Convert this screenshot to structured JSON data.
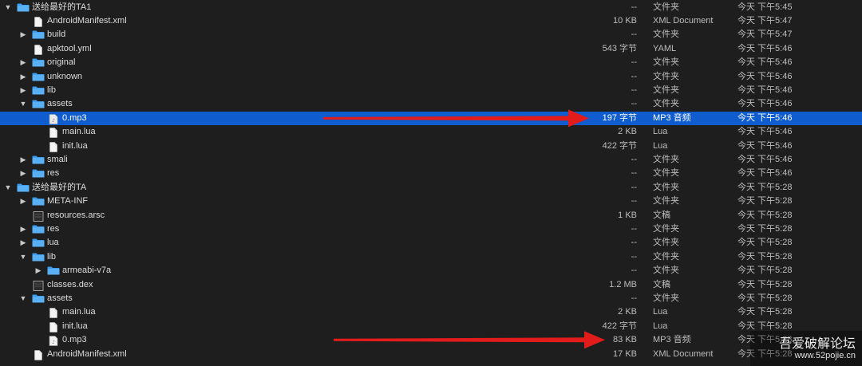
{
  "colors": {
    "background": "#1e1e1e",
    "selection": "#0f5ccf",
    "folder_blue": "#3b9cf0",
    "arrow_red": "#e21b1b"
  },
  "rows": [
    {
      "name": "送给最好的TA1",
      "size": "--",
      "kind": "文件夹",
      "date": "今天 下午5:45",
      "depth": 0,
      "icon": "folder-icon",
      "disclosure": "expanded"
    },
    {
      "name": "AndroidManifest.xml",
      "size": "10 KB",
      "kind": "XML Document",
      "date": "今天 下午5:47",
      "depth": 1,
      "icon": "document-icon",
      "disclosure": "none"
    },
    {
      "name": "build",
      "size": "--",
      "kind": "文件夹",
      "date": "今天 下午5:47",
      "depth": 1,
      "icon": "folder-icon",
      "disclosure": "collapsed"
    },
    {
      "name": "apktool.yml",
      "size": "543 字节",
      "kind": "YAML",
      "date": "今天 下午5:46",
      "depth": 1,
      "icon": "document-icon",
      "disclosure": "none"
    },
    {
      "name": "original",
      "size": "--",
      "kind": "文件夹",
      "date": "今天 下午5:46",
      "depth": 1,
      "icon": "folder-icon",
      "disclosure": "collapsed"
    },
    {
      "name": "unknown",
      "size": "--",
      "kind": "文件夹",
      "date": "今天 下午5:46",
      "depth": 1,
      "icon": "folder-icon",
      "disclosure": "collapsed"
    },
    {
      "name": "lib",
      "size": "--",
      "kind": "文件夹",
      "date": "今天 下午5:46",
      "depth": 1,
      "icon": "folder-icon",
      "disclosure": "collapsed"
    },
    {
      "name": "assets",
      "size": "--",
      "kind": "文件夹",
      "date": "今天 下午5:46",
      "depth": 1,
      "icon": "folder-icon",
      "disclosure": "expanded"
    },
    {
      "name": "0.mp3",
      "size": "197 字节",
      "kind": "MP3 音频",
      "date": "今天 下午5:46",
      "depth": 2,
      "icon": "audio-file-icon",
      "disclosure": "none",
      "selected": true
    },
    {
      "name": "main.lua",
      "size": "2 KB",
      "kind": "Lua",
      "date": "今天 下午5:46",
      "depth": 2,
      "icon": "document-icon",
      "disclosure": "none"
    },
    {
      "name": "init.lua",
      "size": "422 字节",
      "kind": "Lua",
      "date": "今天 下午5:46",
      "depth": 2,
      "icon": "document-icon",
      "disclosure": "none"
    },
    {
      "name": "smali",
      "size": "--",
      "kind": "文件夹",
      "date": "今天 下午5:46",
      "depth": 1,
      "icon": "folder-icon",
      "disclosure": "collapsed"
    },
    {
      "name": "res",
      "size": "--",
      "kind": "文件夹",
      "date": "今天 下午5:46",
      "depth": 1,
      "icon": "folder-icon",
      "disclosure": "collapsed"
    },
    {
      "name": "送给最好的TA",
      "size": "--",
      "kind": "文件夹",
      "date": "今天 下午5:28",
      "depth": 0,
      "icon": "folder-icon",
      "disclosure": "expanded"
    },
    {
      "name": "META-INF",
      "size": "--",
      "kind": "文件夹",
      "date": "今天 下午5:28",
      "depth": 1,
      "icon": "folder-icon",
      "disclosure": "collapsed"
    },
    {
      "name": "resources.arsc",
      "size": "1 KB",
      "kind": "文稿",
      "date": "今天 下午5:28",
      "depth": 1,
      "icon": "binary-file-icon",
      "disclosure": "none"
    },
    {
      "name": "res",
      "size": "--",
      "kind": "文件夹",
      "date": "今天 下午5:28",
      "depth": 1,
      "icon": "folder-icon",
      "disclosure": "collapsed"
    },
    {
      "name": "lua",
      "size": "--",
      "kind": "文件夹",
      "date": "今天 下午5:28",
      "depth": 1,
      "icon": "folder-icon",
      "disclosure": "collapsed"
    },
    {
      "name": "lib",
      "size": "--",
      "kind": "文件夹",
      "date": "今天 下午5:28",
      "depth": 1,
      "icon": "folder-icon",
      "disclosure": "expanded"
    },
    {
      "name": "armeabi-v7a",
      "size": "--",
      "kind": "文件夹",
      "date": "今天 下午5:28",
      "depth": 2,
      "icon": "folder-icon",
      "disclosure": "collapsed"
    },
    {
      "name": "classes.dex",
      "size": "1.2 MB",
      "kind": "文稿",
      "date": "今天 下午5:28",
      "depth": 1,
      "icon": "binary-file-icon",
      "disclosure": "none"
    },
    {
      "name": "assets",
      "size": "--",
      "kind": "文件夹",
      "date": "今天 下午5:28",
      "depth": 1,
      "icon": "folder-icon",
      "disclosure": "expanded"
    },
    {
      "name": "main.lua",
      "size": "2 KB",
      "kind": "Lua",
      "date": "今天 下午5:28",
      "depth": 2,
      "icon": "document-icon",
      "disclosure": "none"
    },
    {
      "name": "init.lua",
      "size": "422 字节",
      "kind": "Lua",
      "date": "今天 下午5:28",
      "depth": 2,
      "icon": "document-icon",
      "disclosure": "none"
    },
    {
      "name": "0.mp3",
      "size": "83 KB",
      "kind": "MP3 音频",
      "date": "今天 下午5:28",
      "depth": 2,
      "icon": "audio-file-icon",
      "disclosure": "none"
    },
    {
      "name": "AndroidManifest.xml",
      "size": "17 KB",
      "kind": "XML Document",
      "date": "今天 下午5:28",
      "depth": 1,
      "icon": "document-icon",
      "disclosure": "none"
    }
  ],
  "annotations": [
    {
      "target_row": 8,
      "icon": "red-arrow"
    },
    {
      "target_row": 24,
      "icon": "red-arrow"
    }
  ],
  "watermark": {
    "title": "吾爱破解论坛",
    "url": "www.52pojie.cn"
  }
}
